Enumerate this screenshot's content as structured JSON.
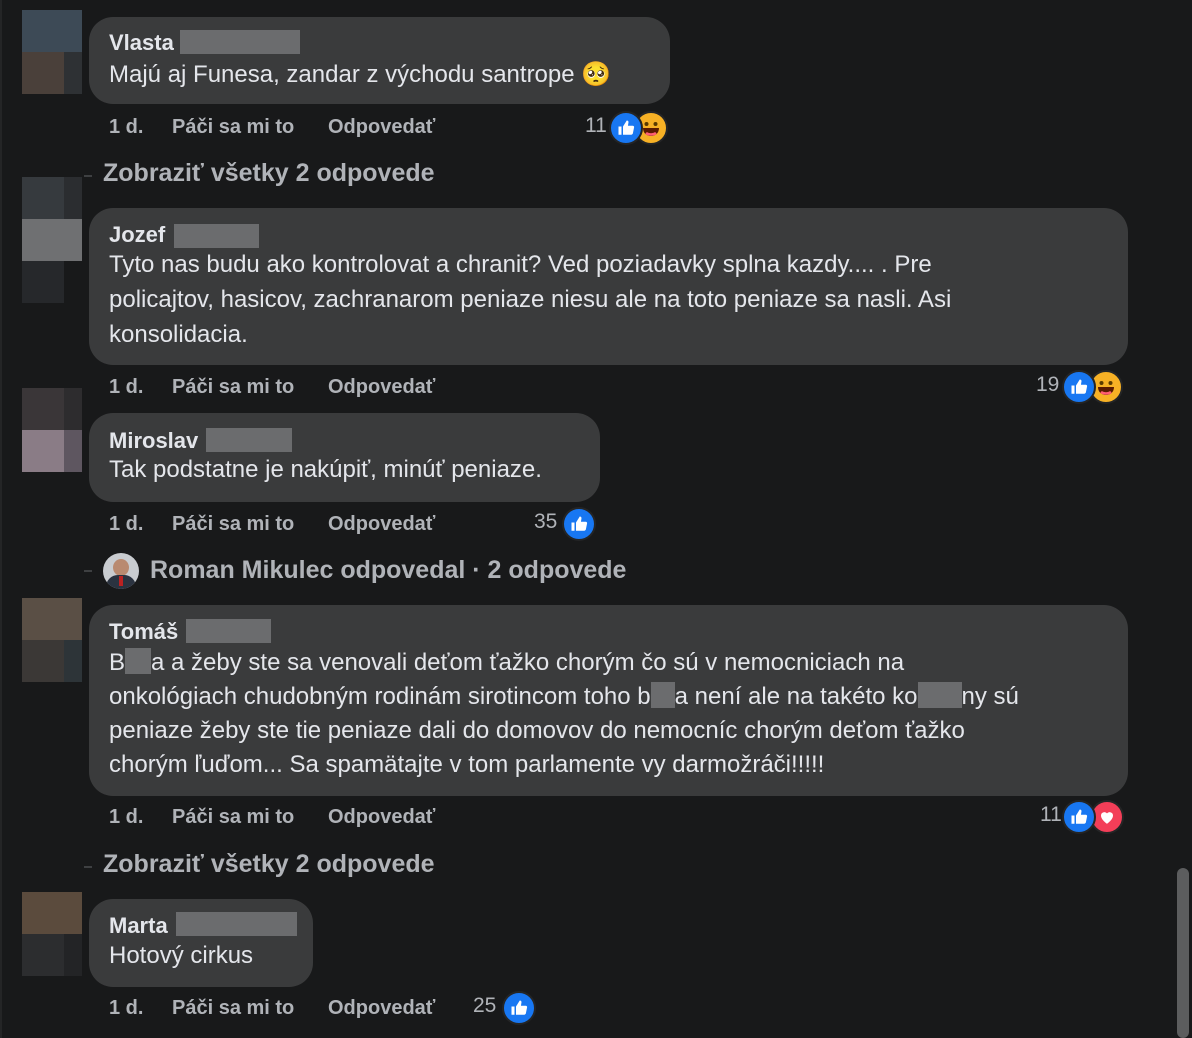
{
  "comments": [
    {
      "author": "Vlasta",
      "text": "Majú aj Funesa, zandar z východu santrope 🥺",
      "time": "1 d.",
      "like_label": "Páči sa mi to",
      "reply_label": "Odpovedať",
      "reaction_count": "11",
      "reactions": [
        "like-icon",
        "haha-icon"
      ]
    },
    {
      "author": "Jozef",
      "text_lines": [
        "Tyto nas budu ako kontrolovat a chranit? Ved poziadavky splna kazdy.... . Pre",
        "policajtov, hasicov, zachranarom peniaze niesu ale na toto peniaze sa nasli. Asi",
        "konsolidacia."
      ],
      "time": "1 d.",
      "like_label": "Páči sa mi to",
      "reply_label": "Odpovedať",
      "reaction_count": "19",
      "reactions": [
        "like-icon",
        "haha-icon"
      ]
    },
    {
      "author": "Miroslav",
      "text": "Tak podstatne je nakúpiť, minúť peniaze.",
      "time": "1 d.",
      "like_label": "Páči sa mi to",
      "reply_label": "Odpovedať",
      "reaction_count": "35",
      "reactions": [
        "like-icon"
      ]
    },
    {
      "author": "Tomáš",
      "line1_a": "B",
      "line1_b": "a a žeby ste sa venovali deťom ťažko chorým čo sú v nemocniciach na",
      "line2_a": "onkológiach chudobným rodinám sirotincom toho b",
      "line2_b": "a není ale na takéto ko",
      "line2_c": "ny sú",
      "line3": "peniaze žeby ste tie peniaze dali do domovov do nemocníc chorým deťom ťažko",
      "line4": "chorým ľuďom... Sa spamätajte v tom parlamente vy darmožráči!!!!!",
      "time": "1 d.",
      "like_label": "Páči sa mi to",
      "reply_label": "Odpovedať",
      "reaction_count": "11",
      "reactions": [
        "like-icon",
        "love-icon"
      ]
    },
    {
      "author": "Marta",
      "text": "Hotový cirkus",
      "time": "1 d.",
      "like_label": "Páči sa mi to",
      "reply_label": "Odpovedať",
      "reaction_count": "25",
      "reactions": [
        "like-icon"
      ]
    }
  ],
  "view_replies_1": "Zobraziť všetky 2 odpovede",
  "reply_summary": "Roman Mikulec odpovedal · 2 odpovede",
  "view_replies_2": "Zobraziť všetky 2 odpovede",
  "colors": {
    "background": "#18191a",
    "bubble": "#3a3b3c",
    "primary_text": "#e4e6eb",
    "secondary_text": "#b0b3b8",
    "like_blue": "#1877f2",
    "love_red": "#f33e58",
    "haha_yellow": "#f7b125"
  }
}
